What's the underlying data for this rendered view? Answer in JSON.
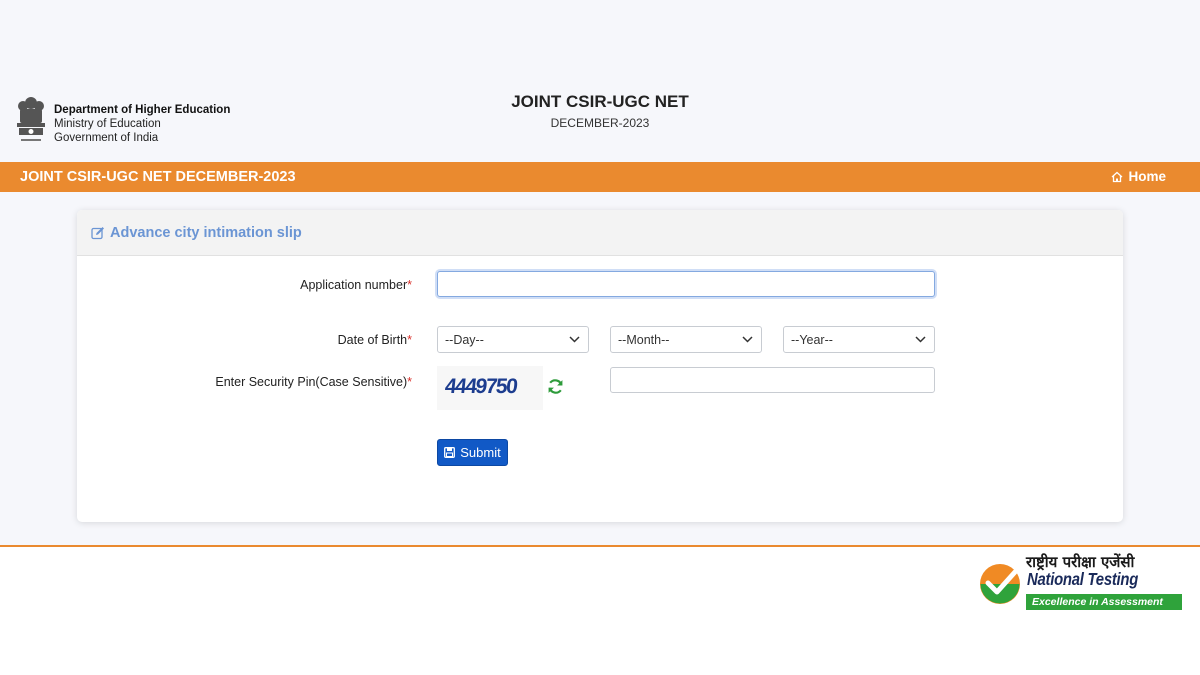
{
  "header": {
    "dept_name": "Department of Higher Education",
    "ministry": "Ministry of Education",
    "government": "Government of India",
    "exam_title": "JOINT CSIR-UGC NET",
    "exam_session": "DECEMBER-2023"
  },
  "navbar": {
    "brand": "JOINT CSIR-UGC NET DECEMBER-2023",
    "home_label": "Home",
    "bg_color": "#ea8a2f"
  },
  "form": {
    "title": "Advance city intimation slip",
    "application_number_label": "Application number",
    "application_number_value": "",
    "dob_label": "Date of Birth",
    "day_selected": "--Day--",
    "month_selected": "--Month--",
    "year_selected": "--Year--",
    "security_pin_label": "Enter Security Pin(Case Sensitive)",
    "captcha_text": "4449750",
    "security_pin_value": "",
    "required_marker": "*",
    "submit_label": "Submit"
  },
  "footer": {
    "agency_hindi": "राष्ट्रीय परीक्षा एजेंसी",
    "agency_name": "National Testing Agency",
    "tagline": "Excellence in Assessment"
  },
  "icons": {
    "emblem": "state-emblem-icon",
    "home": "home-icon",
    "edit": "edit-icon",
    "refresh": "refresh-icon",
    "save": "save-icon",
    "chevron": "chevron-down-icon",
    "nta_logo": "nta-checkmark-logo"
  },
  "colors": {
    "accent_orange": "#ea8a2f",
    "button_blue": "#1159c6",
    "title_blue": "#6b95d4",
    "required_red": "#d9302b",
    "nta_green": "#2fa33b"
  }
}
